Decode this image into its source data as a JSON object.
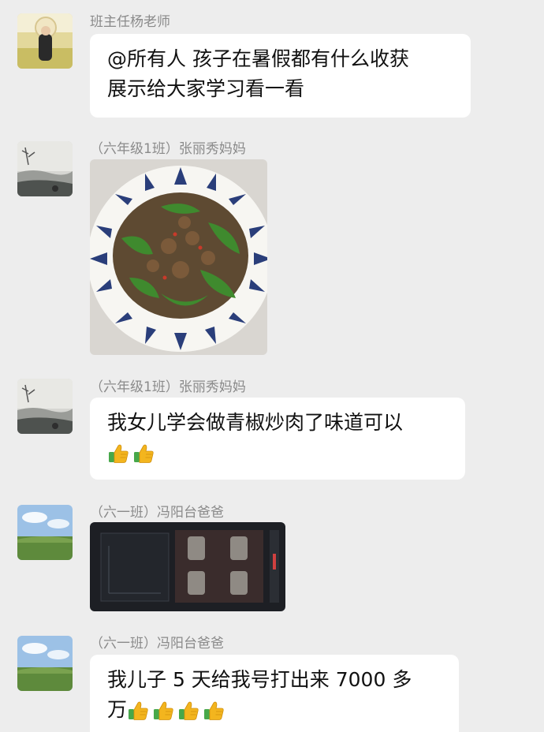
{
  "messages": [
    {
      "sender": "班主任杨老师",
      "avatar": "teacher-avatar",
      "lines": [
        "@所有人 孩子在暑假都有什么收获",
        "展示给大家学习看一看"
      ]
    },
    {
      "sender": "（六年级1班）张丽秀妈妈",
      "avatar": "ink-landscape-avatar",
      "image": "stir-fried-pepper-pork-photo"
    },
    {
      "sender": "（六年级1班）张丽秀妈妈",
      "avatar": "ink-landscape-avatar",
      "lines": [
        "我女儿学会做青椒炒肉了味道可以"
      ],
      "thumbs_count": 2
    },
    {
      "sender": "（六一班）冯阳台爸爸",
      "avatar": "grassland-sky-avatar",
      "image": "game-inventory-screenshot"
    },
    {
      "sender": "（六一班）冯阳台爸爸",
      "avatar": "grassland-sky-avatar",
      "lines": [
        "我儿子 5 天给我号打出来 7000 多",
        "万"
      ],
      "thumbs_count": 4
    }
  ],
  "colors": {
    "background": "#ededed",
    "bubble": "#ffffff",
    "name_text": "#8a8a8a",
    "thumbs_up": "#f2b21b",
    "thumbs_cuff": "#4caf50"
  }
}
